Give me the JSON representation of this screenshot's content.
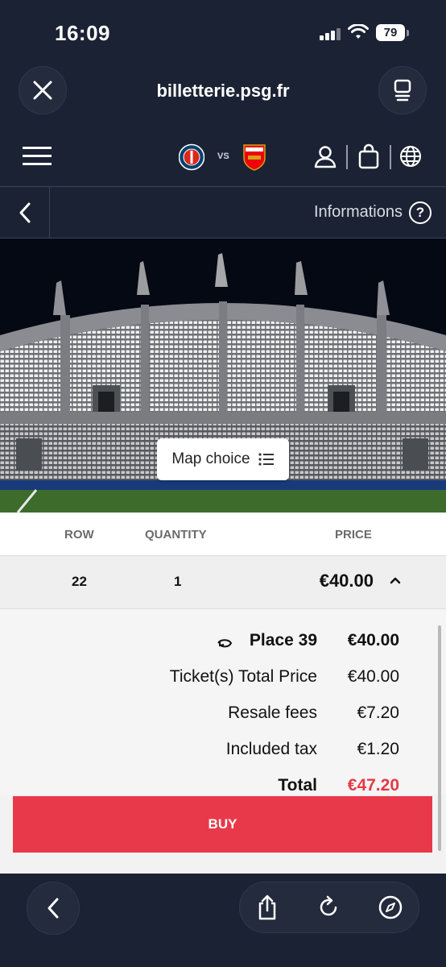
{
  "status": {
    "time": "16:09",
    "battery": "79"
  },
  "browser": {
    "url": "billetterie.psg.fr",
    "close_icon": "close-icon",
    "tabs_icon": "tabs-icon"
  },
  "header": {
    "menu_icon": "hamburger-menu-icon",
    "home_team_icon": "psg-crest",
    "vs_label": "VS",
    "away_team_icon": "arsenal-crest",
    "account_icon": "user-icon",
    "cart_icon": "shopping-bag-icon",
    "language_icon": "globe-icon"
  },
  "subheader": {
    "back_icon": "chevron-left-icon",
    "info_label": "Informations",
    "help_icon": "question-icon"
  },
  "map": {
    "map_choice_label": "Map choice",
    "list_icon": "list-icon"
  },
  "table": {
    "headers": {
      "row": "ROW",
      "quantity": "QUANTITY",
      "price": "PRICE"
    },
    "row": {
      "row": "22",
      "quantity": "1",
      "price": "€40.00"
    }
  },
  "details": {
    "place_label": "Place 39",
    "place_price": "€40.00",
    "ticket_total_label": "Ticket(s) Total Price",
    "ticket_total_value": "€40.00",
    "resale_fees_label": "Resale fees",
    "resale_fees_value": "€7.20",
    "included_tax_label": "Included tax",
    "included_tax_value": "€1.20",
    "total_label": "Total",
    "total_value": "€47.20"
  },
  "buy_label": "BUY",
  "colors": {
    "accent": "#e8394a",
    "navy": "#1b2233"
  }
}
